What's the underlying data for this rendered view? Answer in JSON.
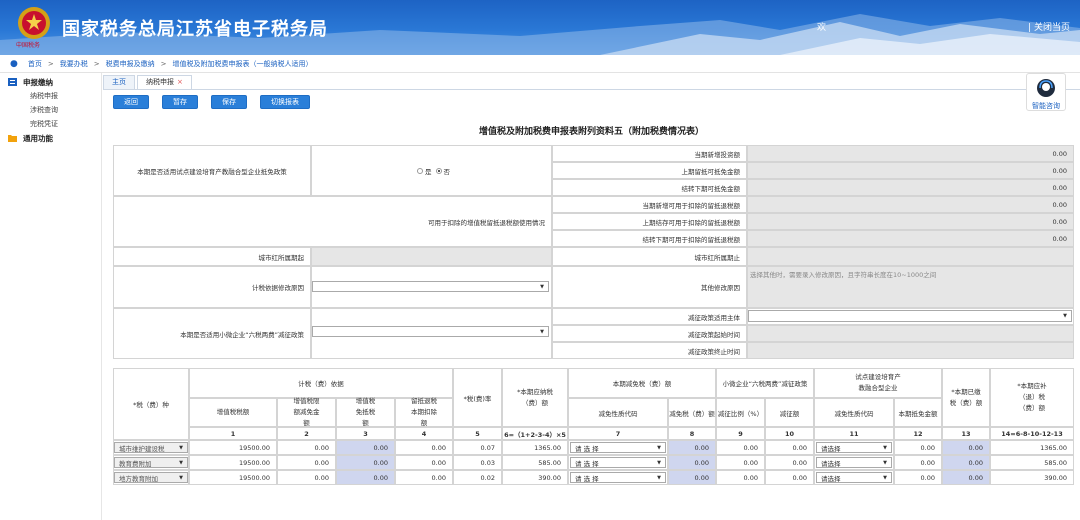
{
  "header": {
    "emblem_text": "中国税务",
    "title": "国家税务总局江苏省电子税务局",
    "welcome": "欢",
    "close": "| 关闭当页"
  },
  "breadcrumb": [
    "首页",
    "我要办税",
    "税费申报及缴纳",
    "增值税及附加税费申报表（一般纳税人适用）"
  ],
  "sidebar": {
    "groups": [
      {
        "label": "申报缴纳",
        "items": [
          "纳税申报",
          "涉税查询",
          "完税凭证"
        ]
      },
      {
        "label": "通用功能",
        "items": []
      }
    ]
  },
  "tabs": [
    {
      "label": "主页"
    },
    {
      "label": "纳税申报",
      "close": "×"
    }
  ],
  "toolbar": [
    "返回",
    "暂存",
    "保存",
    "切换报表"
  ],
  "help_label": "智能咨询",
  "form_title": "增值税及附加税费申报表附列资料五（附加税费情况表）",
  "section1": {
    "policy_label": "本期是否适用试点建设培育产教融合型企业抵免政策",
    "yes": "是",
    "no": "否",
    "rows": [
      {
        "label": "当期新增投资额",
        "value": "0.00"
      },
      {
        "label": "上期留抵可抵免金额",
        "value": "0.00"
      },
      {
        "label": "结转下期可抵免金额",
        "value": "0.00"
      }
    ],
    "refund_label": "可用于扣除的增值税留抵退税额使用情况",
    "refund_rows": [
      {
        "label": "当期新增可用于扣除的留抵退税额",
        "value": "0.00"
      },
      {
        "label": "上期结存可用于扣除的留抵退税额",
        "value": "0.00"
      },
      {
        "label": "结转下期可用于扣除的留抵退税额",
        "value": "0.00"
      }
    ],
    "red_start": "城市红所属期起",
    "red_end": "城市红所属期止",
    "reason_label": "计税依据修改原因",
    "other_reason_label": "其他修改原因",
    "other_reason_placeholder": "选择其他时，需要录入修改原因，且字符串长度在10~1000之间",
    "small_label": "本期是否适用小微企业“六税两费”减征政策",
    "small_rows": [
      "减征政策适用主体",
      "减征政策起始时间",
      "减征政策终止时间"
    ]
  },
  "table": {
    "tax_type_header": "*税（费）种",
    "basis_header": "计税（费）依据",
    "basis_cols": [
      "增值税税额",
      "增值税限额减免金额",
      "增值税免抵税额",
      "留抵退税本期扣除额"
    ],
    "rate_header": "*税(费)率",
    "due_header": "*本期应纳税（费）额",
    "reduce_header": "本期减免税（费）额",
    "reduce_cols": [
      "减免性质代码",
      "减免税（费）额"
    ],
    "small_header": "小微企业“六税两费”减征政策",
    "small_cols": [
      "减征比例（%）",
      "减征额"
    ],
    "pilot_header": "试点建设培育产教融合型企业",
    "pilot_cols": [
      "减免性质代码",
      "本期抵免金额"
    ],
    "paid_header": "*本期已缴税（费）额",
    "refund_header": "*本期应补（退）税（费）额",
    "col_numbers": [
      "1",
      "2",
      "3",
      "4",
      "5",
      "6=（1+2-3-4）×5",
      "7",
      "8",
      "9",
      "10",
      "11",
      "12",
      "13",
      "14=6-8-10-12-13"
    ],
    "rows": [
      {
        "tax": "城市维护建设税",
        "c1": "19500.00",
        "c2": "0.00",
        "c3": "0.00",
        "c4": "0.00",
        "c5": "0.07",
        "c6": "1365.00",
        "c7": "请 选 择",
        "c8": "0.00",
        "c9": "0.00",
        "c10": "0.00",
        "c11": "请选择",
        "c12": "0.00",
        "c13": "0.00",
        "c14": "1365.00"
      },
      {
        "tax": "教育费附加",
        "c1": "19500.00",
        "c2": "0.00",
        "c3": "0.00",
        "c4": "0.00",
        "c5": "0.03",
        "c6": "585.00",
        "c7": "请 选 择",
        "c8": "0.00",
        "c9": "0.00",
        "c10": "0.00",
        "c11": "请选择",
        "c12": "0.00",
        "c13": "0.00",
        "c14": "585.00"
      },
      {
        "tax": "地方教育附加",
        "c1": "19500.00",
        "c2": "0.00",
        "c3": "0.00",
        "c4": "0.00",
        "c5": "0.02",
        "c6": "390.00",
        "c7": "请 选 择",
        "c8": "0.00",
        "c9": "0.00",
        "c10": "0.00",
        "c11": "请选择",
        "c12": "0.00",
        "c13": "0.00",
        "c14": "390.00"
      }
    ]
  },
  "colors": {
    "header_blue": "#2a78d6",
    "button_blue": "#2a7fd9",
    "gray_cell": "#e6e6e6",
    "blue_cell": "#cfd6ef"
  }
}
